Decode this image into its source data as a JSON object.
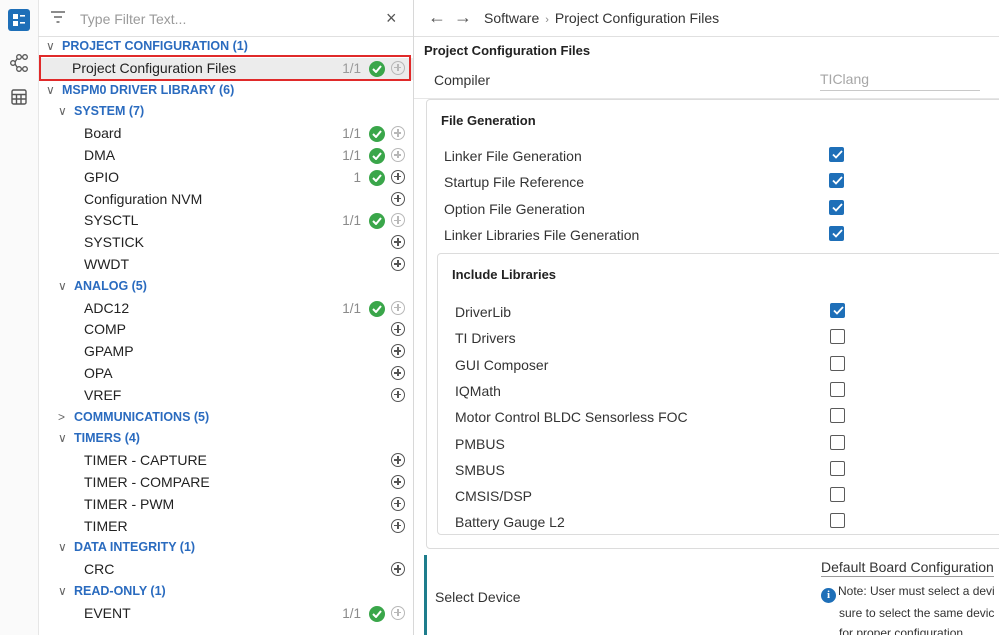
{
  "rail": {
    "items": [
      "list-view-icon",
      "network-icon",
      "table-icon"
    ]
  },
  "filter": {
    "placeholder": "Type Filter Text...",
    "value": "",
    "close_label": "×"
  },
  "tree": [
    {
      "type": "cat",
      "level": 0,
      "expanded": true,
      "label": "PROJECT CONFIGURATION (1)"
    },
    {
      "type": "item",
      "level": 1,
      "label": "Project Configuration Files",
      "count": "1/1",
      "ok": true,
      "add": "dim",
      "selected": true
    },
    {
      "type": "cat",
      "level": 0,
      "expanded": true,
      "label": "MSPM0 DRIVER LIBRARY (6)"
    },
    {
      "type": "cat",
      "level": 1,
      "expanded": true,
      "label": "SYSTEM (7)"
    },
    {
      "type": "item",
      "level": 2,
      "label": "Board",
      "count": "1/1",
      "ok": true,
      "add": "dim"
    },
    {
      "type": "item",
      "level": 2,
      "label": "DMA",
      "count": "1/1",
      "ok": true,
      "add": "dim"
    },
    {
      "type": "item",
      "level": 2,
      "label": "GPIO",
      "count": "1",
      "ok": true,
      "add": "active"
    },
    {
      "type": "item",
      "level": 2,
      "label": "Configuration NVM",
      "count": "",
      "ok": false,
      "add": "active"
    },
    {
      "type": "item",
      "level": 2,
      "label": "SYSCTL",
      "count": "1/1",
      "ok": true,
      "add": "dim"
    },
    {
      "type": "item",
      "level": 2,
      "label": "SYSTICK",
      "count": "",
      "ok": false,
      "add": "active"
    },
    {
      "type": "item",
      "level": 2,
      "label": "WWDT",
      "count": "",
      "ok": false,
      "add": "active"
    },
    {
      "type": "cat",
      "level": 1,
      "expanded": true,
      "label": "ANALOG (5)"
    },
    {
      "type": "item",
      "level": 2,
      "label": "ADC12",
      "count": "1/1",
      "ok": true,
      "add": "dim"
    },
    {
      "type": "item",
      "level": 2,
      "label": "COMP",
      "count": "",
      "ok": false,
      "add": "active"
    },
    {
      "type": "item",
      "level": 2,
      "label": "GPAMP",
      "count": "",
      "ok": false,
      "add": "active"
    },
    {
      "type": "item",
      "level": 2,
      "label": "OPA",
      "count": "",
      "ok": false,
      "add": "active"
    },
    {
      "type": "item",
      "level": 2,
      "label": "VREF",
      "count": "",
      "ok": false,
      "add": "active"
    },
    {
      "type": "cat",
      "level": 1,
      "expanded": false,
      "label": "COMMUNICATIONS (5)"
    },
    {
      "type": "cat",
      "level": 1,
      "expanded": true,
      "label": "TIMERS (4)"
    },
    {
      "type": "item",
      "level": 2,
      "label": "TIMER - CAPTURE",
      "count": "",
      "ok": false,
      "add": "active"
    },
    {
      "type": "item",
      "level": 2,
      "label": "TIMER - COMPARE",
      "count": "",
      "ok": false,
      "add": "active"
    },
    {
      "type": "item",
      "level": 2,
      "label": "TIMER - PWM",
      "count": "",
      "ok": false,
      "add": "active"
    },
    {
      "type": "item",
      "level": 2,
      "label": "TIMER",
      "count": "",
      "ok": false,
      "add": "active"
    },
    {
      "type": "cat",
      "level": 1,
      "expanded": true,
      "label": "DATA INTEGRITY (1)"
    },
    {
      "type": "item",
      "level": 2,
      "label": "CRC",
      "count": "",
      "ok": false,
      "add": "active"
    },
    {
      "type": "cat",
      "level": 1,
      "expanded": true,
      "label": "READ-ONLY (1)"
    },
    {
      "type": "item",
      "level": 2,
      "label": "EVENT",
      "count": "1/1",
      "ok": true,
      "add": "dim"
    }
  ],
  "nav": {
    "back": "←",
    "forward": "→",
    "crumb_root": "Software",
    "crumb_sep": "›",
    "crumb_current": "Project Configuration Files"
  },
  "main": {
    "title": "Project Configuration Files",
    "compiler_label": "Compiler",
    "compiler_value": "TIClang",
    "file_generation": {
      "title": "File Generation",
      "options": [
        {
          "label": "Linker File Generation",
          "checked": true
        },
        {
          "label": "Startup File Reference",
          "checked": true
        },
        {
          "label": "Option File Generation",
          "checked": true
        },
        {
          "label": "Linker Libraries File Generation",
          "checked": true
        }
      ]
    },
    "include_libraries": {
      "title": "Include Libraries",
      "options": [
        {
          "label": "DriverLib",
          "checked": true
        },
        {
          "label": "TI Drivers",
          "checked": false
        },
        {
          "label": "GUI Composer",
          "checked": false
        },
        {
          "label": "IQMath",
          "checked": false
        },
        {
          "label": "Motor Control BLDC Sensorless FOC",
          "checked": false
        },
        {
          "label": "PMBUS",
          "checked": false
        },
        {
          "label": "SMBUS",
          "checked": false
        },
        {
          "label": "CMSIS/DSP",
          "checked": false
        },
        {
          "label": "Battery Gauge L2",
          "checked": false
        }
      ]
    },
    "device": {
      "label": "Select Device",
      "board_config": "Default Board Configuration",
      "note_lines": [
        "Note: User must select a devi",
        "sure to select the same devic",
        "for proper configuration."
      ]
    }
  },
  "colors": {
    "accent": "#1e6fb8",
    "category": "#2a6bbf",
    "ok": "#3aa64a",
    "highlight": "#e02a2a",
    "device_bar": "#1e7d8c"
  }
}
